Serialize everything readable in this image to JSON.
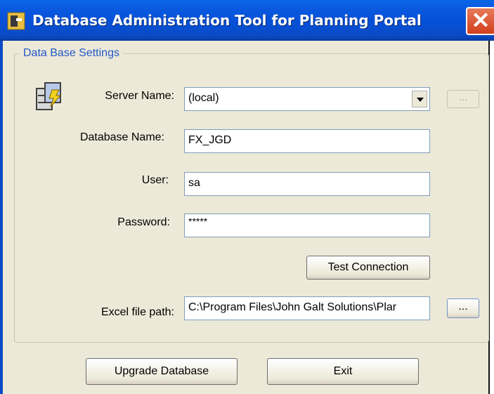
{
  "window": {
    "title": "Database Administration Tool for Planning Portal",
    "close_glyph": "✕"
  },
  "group": {
    "legend": "Data Base Settings"
  },
  "form": {
    "server_label": "Server Name:",
    "server_value": "(local)",
    "browse_server_label": "...",
    "database_label": "Database Name:",
    "database_value": "FX_JGD",
    "user_label": "User:",
    "user_value": "sa",
    "password_label": "Password:",
    "password_value": "*****",
    "test_connection_label": "Test Connection",
    "excel_label": "Excel file path:",
    "excel_value": "C:\\Program Files\\John Galt Solutions\\Plar",
    "browse_excel_label": "..."
  },
  "footer": {
    "upgrade_label": "Upgrade Database",
    "exit_label": "Exit"
  },
  "colors": {
    "titlebar": "#0650d8",
    "dialog_bg": "#ece9d8",
    "legend_text": "#2158c8",
    "close_button": "#d2401c"
  },
  "icons": {
    "app": "app-logo-icon",
    "server": "database-server-icon",
    "close": "close-icon",
    "dropdown": "chevron-down-icon"
  }
}
